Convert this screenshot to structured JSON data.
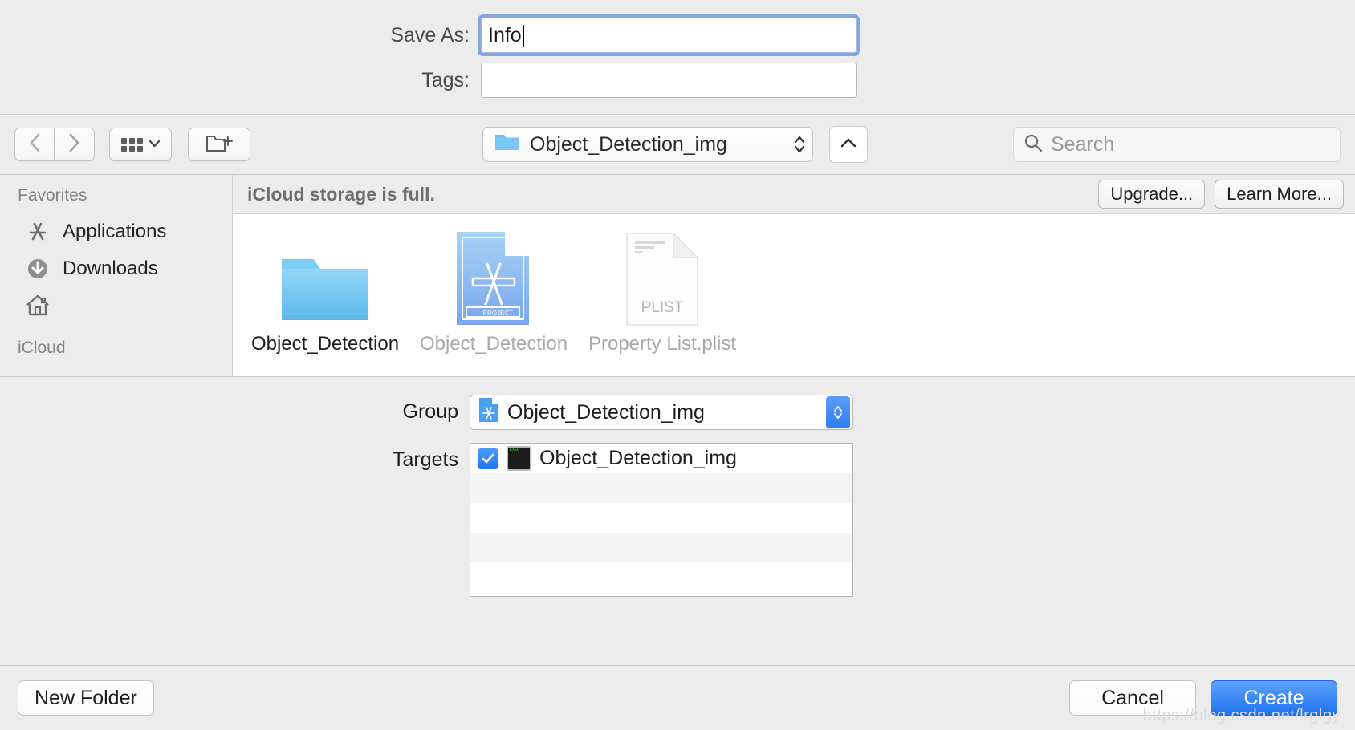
{
  "save_panel": {
    "save_as_label": "Save As:",
    "save_as_value": "Info",
    "tags_label": "Tags:",
    "tags_value": "",
    "tags_placeholder": ""
  },
  "toolbar": {
    "back_icon": "chevron-left-icon",
    "forward_icon": "chevron-right-icon",
    "view_icon": "icon-view-grid-icon",
    "new_folder_icon": "new-folder-icon",
    "location": "Object_Detection_img",
    "location_icon": "blue-folder-icon",
    "collapse_icon": "chevron-up-icon",
    "search_placeholder": "Search",
    "search_value": "",
    "search_icon": "search-icon"
  },
  "sidebar": {
    "sections": [
      {
        "title": "Favorites",
        "items": [
          {
            "label": "Applications",
            "icon": "applications-icon"
          },
          {
            "label": "Downloads",
            "icon": "downloads-icon"
          },
          {
            "label": "",
            "icon": "home-icon",
            "redacted": true
          }
        ]
      },
      {
        "title": "iCloud",
        "items": []
      }
    ]
  },
  "content": {
    "icloud_message": "iCloud storage is full.",
    "upgrade_label": "Upgrade...",
    "learn_more_label": "Learn More...",
    "files": [
      {
        "name": "Object_Detection",
        "icon": "folder-icon",
        "enabled": true
      },
      {
        "name": "Object_Detection",
        "icon": "xcode-project-icon",
        "enabled": false
      },
      {
        "name": "Property List.plist",
        "icon": "plist-document-icon",
        "enabled": false
      }
    ],
    "plist_badge": "PLIST",
    "project_badge": "PROJECT"
  },
  "accessory": {
    "group_label": "Group",
    "group_value": "Object_Detection_img",
    "group_icon": "xcode-project-small-icon",
    "targets_label": "Targets",
    "targets": [
      {
        "name": "Object_Detection_img",
        "checked": true,
        "icon": "exec-target-icon"
      }
    ]
  },
  "footer": {
    "new_folder_label": "New Folder",
    "cancel_label": "Cancel",
    "create_label": "Create"
  },
  "watermark": "https://blog.csdn.net/lrglgy",
  "colors": {
    "accent": "#1d72f0",
    "window_bg": "#ececec",
    "content_bg": "#ffffff",
    "redaction": "#ee3b1a"
  }
}
